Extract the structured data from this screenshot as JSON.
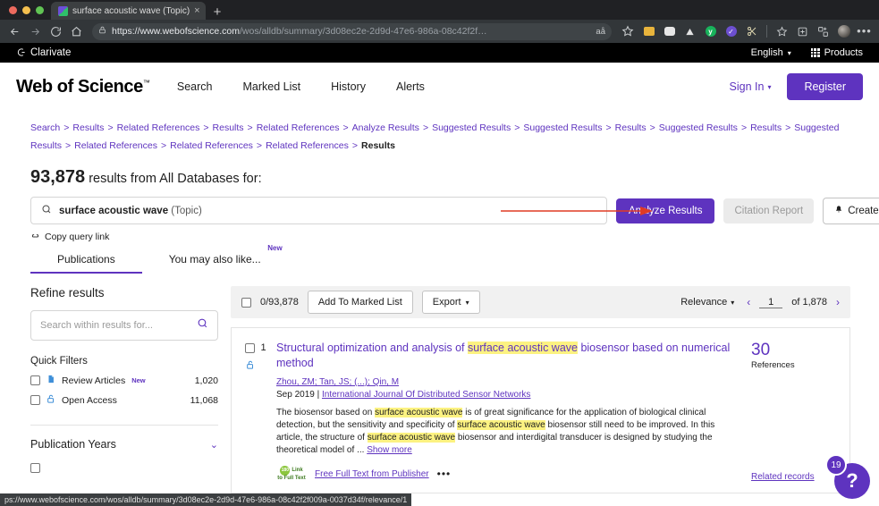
{
  "browser": {
    "tab": {
      "title": "surface acoustic wave (Topic)",
      "close_label": "×",
      "favicon": "wos-favicon"
    },
    "new_tab_label": "+",
    "url_secure": "https://www.webofscience.com",
    "url_path": "/wos/alldb/summary/3d08ec2e-2d9d-47e6-986a-08c42f2f…",
    "reader_label": "aå",
    "status_url": "ps://www.webofscience.com/wos/alldb/summary/3d08ec2e-2d9d-47e6-986a-08c42f2f009a-0037d34f/relevance/1"
  },
  "clarivate": {
    "brand": "Clarivate",
    "language": "English",
    "products": "Products"
  },
  "header": {
    "logo": "Web of Science",
    "logo_tm": "™",
    "nav": [
      "Search",
      "Marked List",
      "History",
      "Alerts"
    ],
    "sign_in": "Sign In",
    "register": "Register"
  },
  "breadcrumb": {
    "items": [
      "Search",
      "Results",
      "Related References",
      "Results",
      "Related References",
      "Analyze Results",
      "Suggested Results",
      "Suggested Results",
      "Results",
      "Suggested Results",
      "Results",
      "Suggested Results",
      "Related References",
      "Related References",
      "Related References"
    ],
    "current": "Results",
    "separator": ">"
  },
  "results_header": {
    "count": "93,878",
    "text": " results from All Databases for:"
  },
  "query": {
    "term": "surface acoustic wave",
    "field": "(Topic)",
    "search_icon": "search-icon",
    "analyze_label": "Analyze Results",
    "citation_label": "Citation Report",
    "alert_label": "Create Alert",
    "alert_icon": "bell-icon",
    "copy_query": "Copy query link",
    "copy_icon": "link-icon",
    "arrow_color": "#e03b24"
  },
  "tabs": [
    {
      "label": "Publications",
      "active": true,
      "badge": ""
    },
    {
      "label": "You may also like...",
      "active": false,
      "badge": "New"
    }
  ],
  "sidebar": {
    "title": "Refine results",
    "search_placeholder": "Search within results for...",
    "search_value": "",
    "quick_filters_title": "Quick Filters",
    "filters": [
      {
        "label": "Review Articles",
        "badge": "New",
        "count": "1,020",
        "icon": "document-icon"
      },
      {
        "label": "Open Access",
        "badge": "",
        "count": "11,068",
        "icon": "open-lock-icon"
      }
    ],
    "sections": [
      {
        "label": "Publication Years",
        "chevron": "⌄"
      }
    ]
  },
  "toolbar": {
    "selected_count": "0/93,878",
    "add_to_marked": "Add To Marked List",
    "export": "Export",
    "sort_label": "Relevance",
    "prev": "‹",
    "next": "›",
    "page_value": "1",
    "page_total": "of 1,878"
  },
  "results": [
    {
      "index": "1",
      "access_icon": "open-lock-icon",
      "title_pre": "Structural optimization and analysis of ",
      "title_hl": "surface acoustic wave",
      "title_post": " biosensor based on numerical method",
      "authors": "Zhou, ZM; Tan, JS; (...); Qin, M",
      "date": "Sep 2019",
      "journal": "International Journal Of Distributed Sensor Networks",
      "abstract_parts": [
        {
          "t": "The biosensor based on ",
          "hl": false
        },
        {
          "t": "surface acoustic wave",
          "hl": true
        },
        {
          "t": " is of great significance for the application of biological clinical detection, but the sensitivity and specificity of ",
          "hl": false
        },
        {
          "t": "surface acoustic wave",
          "hl": true
        },
        {
          "t": " biosensor still need to be improved. In this article, the structure of ",
          "hl": false
        },
        {
          "t": "surface acoustic wave",
          "hl": true
        },
        {
          "t": " biosensor and interdigital transducer is designed by studying the theoretical model of ",
          "hl": false
        }
      ],
      "show_more": "Show more",
      "ellipsis": "...",
      "link_badge_top": "Link",
      "link_badge_bottom": "to Full Text",
      "full_text_link": "Free Full Text from Publisher",
      "more_dots": "•••",
      "references_count": "30",
      "references_label": "References",
      "related_records": "Related records"
    }
  ],
  "help": {
    "icon": "question-mark-icon",
    "badge_count": "19"
  }
}
